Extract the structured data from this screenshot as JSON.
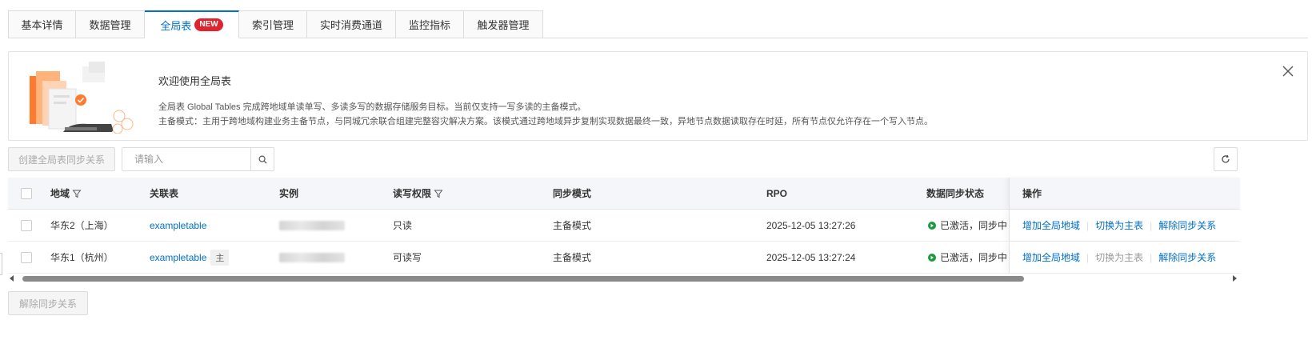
{
  "tabs": [
    {
      "label": "基本详情"
    },
    {
      "label": "数据管理"
    },
    {
      "label": "全局表",
      "badge": "NEW",
      "active": true
    },
    {
      "label": "索引管理"
    },
    {
      "label": "实时消费通道"
    },
    {
      "label": "监控指标"
    },
    {
      "label": "触发器管理"
    }
  ],
  "welcome": {
    "title": "欢迎使用全局表",
    "desc1": "全局表 Global Tables 完成跨地域单读单写、多读多写的数据存储服务目标。当前仅支持一写多读的主备模式。",
    "desc2": "主备模式：主用于跨地域构建业务主备节点，与同城冗余联合组建完整容灾解决方案。该模式通过跨地域异步复制实现数据最终一致，异地节点数据读取存在时延，所有节点仅允许存在一个写入节点。"
  },
  "toolbar": {
    "create_label": "创建全局表同步关系",
    "search_placeholder": "请输入"
  },
  "table": {
    "headers": {
      "region": "地域",
      "table": "关联表",
      "instance": "实例",
      "rw": "读写权限",
      "sync_mode": "同步模式",
      "rpo": "RPO",
      "sync_status": "数据同步状态",
      "ops": "操作"
    },
    "rows": [
      {
        "region": "华东2（上海）",
        "table": "exampletable",
        "main_tag": "",
        "rw": "只读",
        "sync_mode": "主备模式",
        "rpo": "2025-12-05 13:27:26",
        "status": "已激活，同步中",
        "op_add": "增加全局地域",
        "op_switch": "切换为主表",
        "op_remove": "解除同步关系"
      },
      {
        "region": "华东1（杭州）",
        "table": "exampletable",
        "main_tag": "主",
        "rw": "可读写",
        "sync_mode": "主备模式",
        "rpo": "2025-12-05 13:27:24",
        "status": "已激活，同步中",
        "op_add": "增加全局地域",
        "op_switch": "切换为主表",
        "op_remove": "解除同步关系"
      }
    ]
  },
  "bottom": {
    "remove_label": "解除同步关系"
  },
  "colors": {
    "accent": "#0070cc",
    "badge": "#e0242e",
    "status_ok": "#1b9a3e"
  }
}
